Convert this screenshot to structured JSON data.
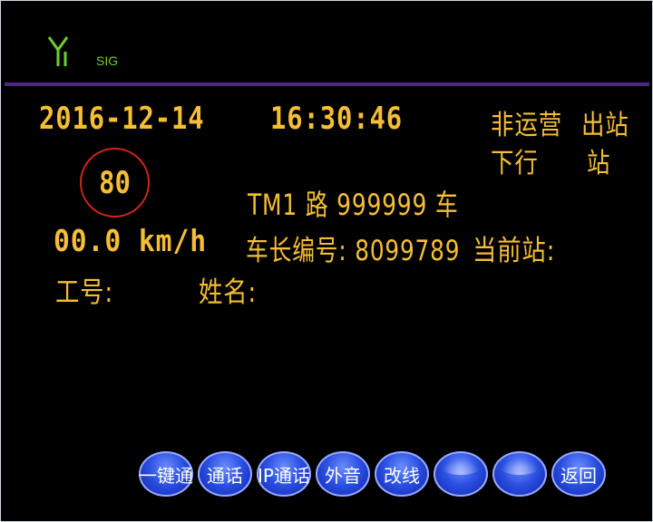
{
  "signal": {
    "label": "SIG",
    "icon": "antenna-icon",
    "color": "#6fcf2c"
  },
  "status": {
    "date": "2016-12-14",
    "time": "16:30:46",
    "mode": "非运营",
    "station_state": "出站",
    "direction": "下行",
    "station_suffix": "站"
  },
  "speed_limit": "80",
  "route": "TM1 路 999999 车",
  "speed": "00.0 km/h",
  "driver_no": "车长编号: 8099789",
  "current_station": "当前站:",
  "job_no": "工号:",
  "name": "姓名:",
  "buttons": [
    "一键通",
    "通话",
    "IP通话",
    "外音",
    "改线",
    "",
    "",
    "返回"
  ],
  "colors": {
    "text": "#f5be33",
    "divider": "#4b2a86",
    "limit_ring": "#d4241e",
    "button": "#2a4fe0"
  }
}
